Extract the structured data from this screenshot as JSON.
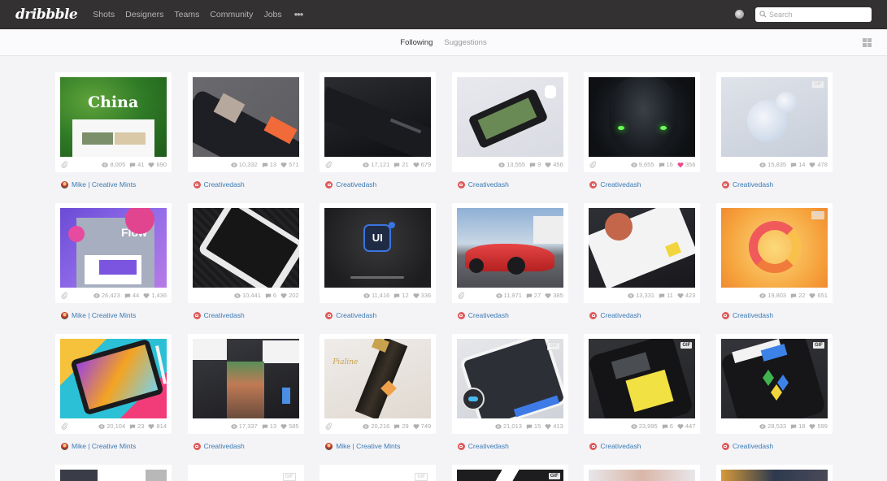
{
  "topbar": {
    "logo": "dribbble",
    "nav": [
      "Shots",
      "Designers",
      "Teams",
      "Community",
      "Jobs"
    ],
    "more_label": "•••",
    "search_placeholder": "Search"
  },
  "subnav": {
    "tabs": [
      {
        "label": "Following",
        "active": true
      },
      {
        "label": "Suggestions",
        "active": false
      }
    ]
  },
  "colors": {
    "accent_link": "#3a7bb4",
    "liked_heart": "#ea4c89",
    "topbar_bg": "#333132"
  },
  "shots": [
    {
      "thumb": "china",
      "gif": false,
      "attach": true,
      "views": "8,005",
      "comments": "41",
      "likes": "690",
      "liked": false,
      "author": "Mike | Creative Mints",
      "avatar": "mike"
    },
    {
      "thumb": "phone1",
      "gif": false,
      "attach": false,
      "views": "10,332",
      "comments": "13",
      "likes": "571",
      "liked": false,
      "author": "Creativedash",
      "avatar": "cd"
    },
    {
      "thumb": "keyboard",
      "gif": false,
      "attach": true,
      "views": "17,121",
      "comments": "21",
      "likes": "679",
      "liked": false,
      "author": "Creativedash",
      "avatar": "cd"
    },
    {
      "thumb": "phone-white",
      "gif": false,
      "attach": false,
      "views": "13,555",
      "comments": "9",
      "likes": "456",
      "liked": false,
      "author": "Creativedash",
      "avatar": "cd"
    },
    {
      "thumb": "helmet",
      "gif": false,
      "attach": true,
      "views": "9,655",
      "comments": "16",
      "likes": "356",
      "liked": true,
      "author": "Creativedash",
      "avatar": "cd"
    },
    {
      "thumb": "blob",
      "gif": "light",
      "attach": false,
      "views": "15,835",
      "comments": "14",
      "likes": "478",
      "liked": false,
      "author": "Creativedash",
      "avatar": "cd"
    },
    {
      "thumb": "flow",
      "gif": false,
      "attach": true,
      "views": "26,423",
      "comments": "44",
      "likes": "1,436",
      "liked": false,
      "author": "Mike | Creative Mints",
      "avatar": "mike"
    },
    {
      "thumb": "ipad",
      "gif": false,
      "attach": false,
      "views": "10,441",
      "comments": "6",
      "likes": "202",
      "liked": false,
      "author": "Creativedash",
      "avatar": "cd"
    },
    {
      "thumb": "ui",
      "gif": false,
      "attach": false,
      "views": "11,416",
      "comments": "12",
      "likes": "336",
      "liked": false,
      "author": "Creativedash",
      "avatar": "cd"
    },
    {
      "thumb": "car",
      "gif": false,
      "attach": true,
      "views": "11,971",
      "comments": "27",
      "likes": "385",
      "liked": false,
      "author": "Creativedash",
      "avatar": "cd"
    },
    {
      "thumb": "profile",
      "gif": false,
      "attach": false,
      "views": "13,331",
      "comments": "11",
      "likes": "423",
      "liked": false,
      "author": "Creativedash",
      "avatar": "cd"
    },
    {
      "thumb": "ring",
      "gif": "light",
      "attach": false,
      "views": "19,803",
      "comments": "22",
      "likes": "651",
      "liked": false,
      "author": "Creativedash",
      "avatar": "cd"
    },
    {
      "thumb": "tablet-color",
      "gif": false,
      "attach": true,
      "views": "20,104",
      "comments": "23",
      "likes": "814",
      "liked": false,
      "author": "Mike | Creative Mints",
      "avatar": "mike"
    },
    {
      "thumb": "dark-collage",
      "gif": false,
      "attach": false,
      "views": "17,337",
      "comments": "13",
      "likes": "585",
      "liked": false,
      "author": "Creativedash",
      "avatar": "cd"
    },
    {
      "thumb": "champagne",
      "gif": false,
      "attach": true,
      "views": "20,216",
      "comments": "29",
      "likes": "749",
      "liked": false,
      "author": "Mike | Creative Mints",
      "avatar": "mike"
    },
    {
      "thumb": "chat",
      "gif": "light",
      "attach": false,
      "views": "21,013",
      "comments": "15",
      "likes": "413",
      "liked": false,
      "author": "Creativedash",
      "avatar": "cd"
    },
    {
      "thumb": "yellow",
      "gif": "dark",
      "attach": false,
      "views": "23,995",
      "comments": "6",
      "likes": "447",
      "liked": false,
      "author": "Creativedash",
      "avatar": "cd"
    },
    {
      "thumb": "cubes",
      "gif": "dark",
      "attach": false,
      "views": "28,533",
      "comments": "18",
      "likes": "599",
      "liked": false,
      "author": "Creativedash",
      "avatar": "cd"
    }
  ],
  "gif_label": "GIF",
  "partial_row": [
    {
      "gif": false
    },
    {
      "gif": "light"
    },
    {
      "gif": "light"
    },
    {
      "gif": "dark"
    },
    {
      "gif": false
    },
    {
      "gif": false
    }
  ]
}
